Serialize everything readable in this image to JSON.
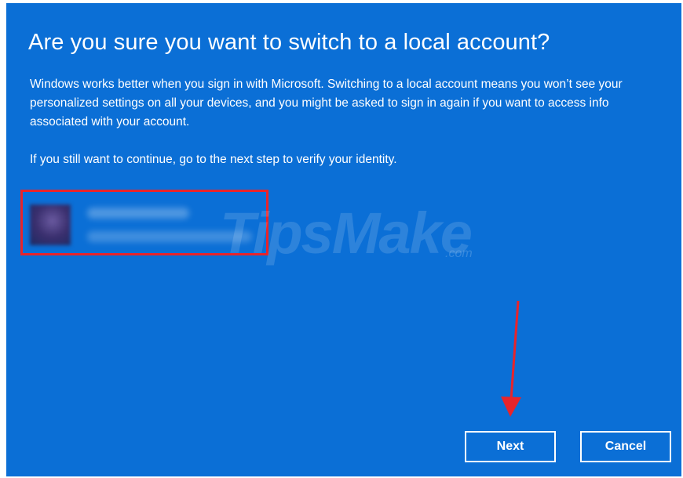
{
  "dialog": {
    "title": "Are you sure you want to switch to a local account?",
    "paragraph1": "Windows works better when you sign in with Microsoft. Switching to a local account means you won’t see your personalized settings on all your devices, and you might be asked to sign in again if you want to access info associated with your account.",
    "paragraph2": "If you still want to continue, go to the next step to verify your identity.",
    "background_color": "#0b6fd6"
  },
  "account": {
    "highlight_color": "#e8242b"
  },
  "watermark": {
    "text": "TipsMake",
    "suffix": ".com"
  },
  "buttons": {
    "next_label": "Next",
    "cancel_label": "Cancel"
  },
  "annotation": {
    "arrow_color": "#e8242b"
  }
}
